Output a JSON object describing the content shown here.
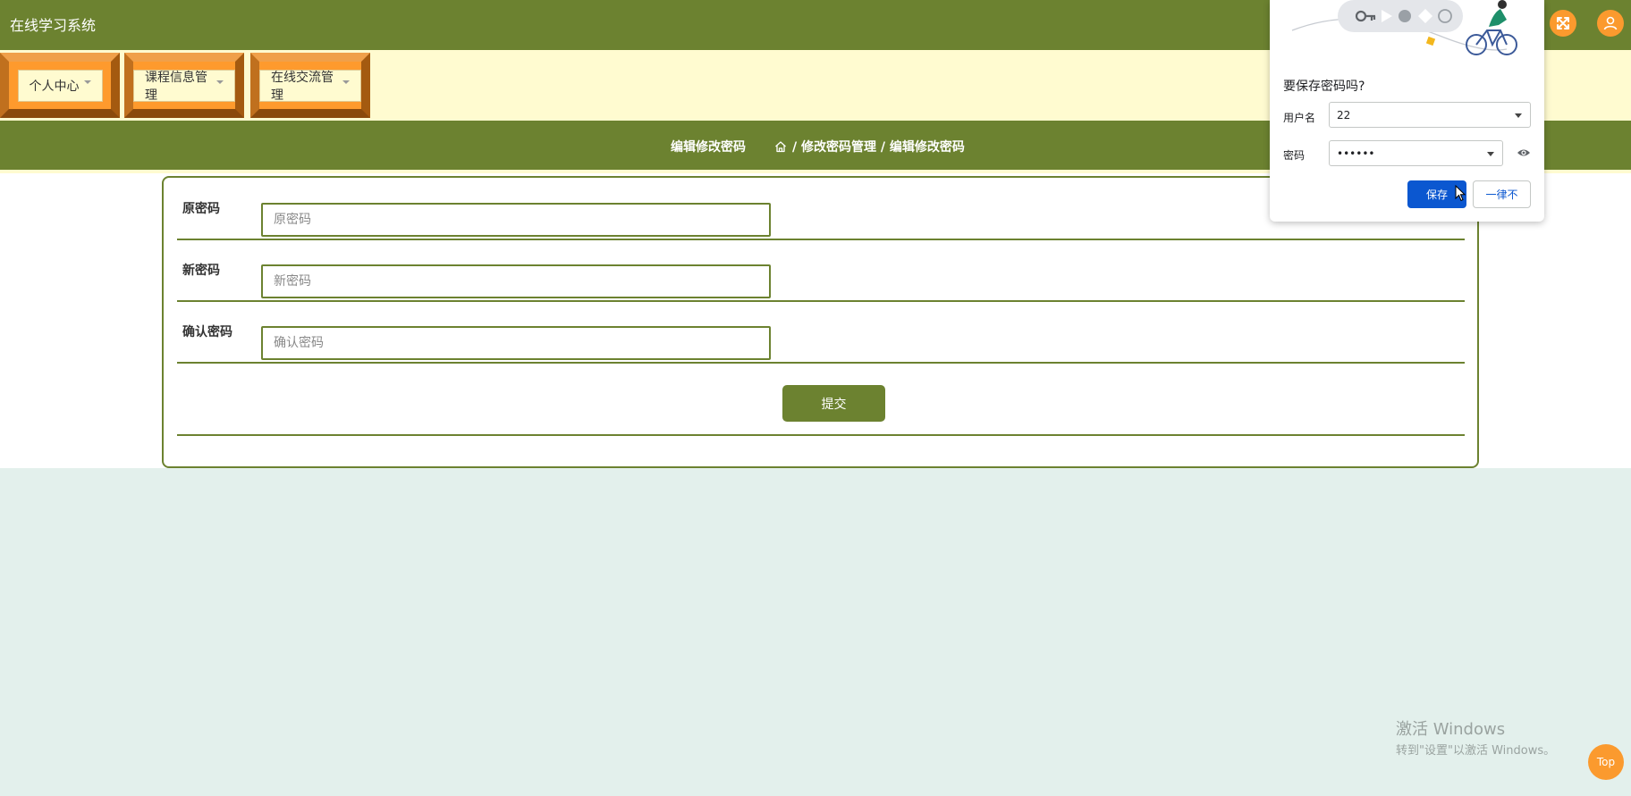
{
  "app": {
    "title": "在线学习系统"
  },
  "header_buttons": [
    {
      "icon": "expand-icon"
    },
    {
      "icon": "user-icon"
    }
  ],
  "menu": [
    {
      "label": "个人中心"
    },
    {
      "label": "课程信息管理"
    },
    {
      "label": "在线交流管理"
    }
  ],
  "page": {
    "title": "编辑修改密码",
    "breadcrumb": "/ 修改密码管理 / 编辑修改密码"
  },
  "form": {
    "old_password": {
      "label": "原密码",
      "placeholder": "原密码"
    },
    "new_password": {
      "label": "新密码",
      "placeholder": "新密码"
    },
    "confirm_password": {
      "label": "确认密码",
      "placeholder": "确认密码"
    },
    "submit_label": "提交"
  },
  "password_popup": {
    "title": "要保存密码吗?",
    "username_label": "用户名",
    "username_value": "22",
    "password_label": "密码",
    "password_value": "••••••",
    "save_label": "保存",
    "never_label": "一律不"
  },
  "watermark": {
    "title": "激活 Windows",
    "subtitle": "转到\"设置\"以激活 Windows。"
  },
  "back_to_top": "Top",
  "colors": {
    "primary_green": "#6c8230",
    "accent_orange": "#fe9a2d",
    "menu_band": "#fffbd0",
    "page_bg": "#e3f0ec",
    "popup_blue": "#0b57d0"
  }
}
